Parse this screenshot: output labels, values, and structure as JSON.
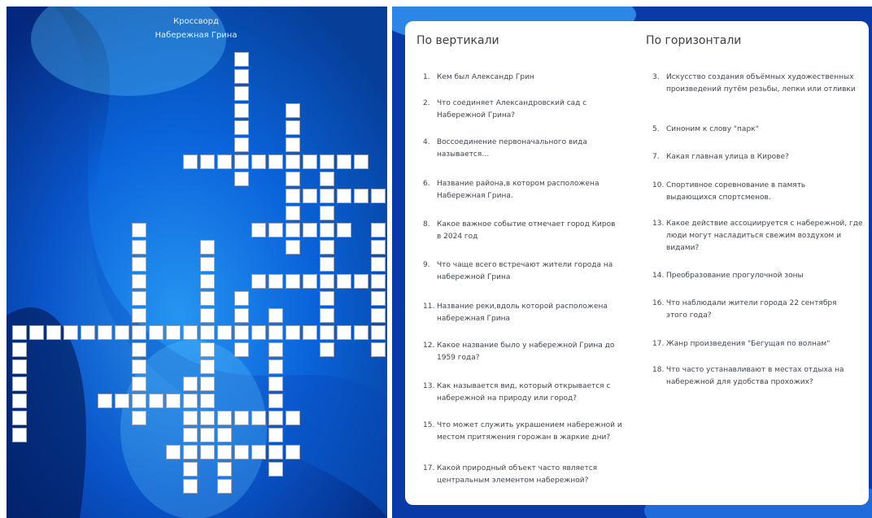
{
  "crossword": {
    "title_line1": "Кроссворд",
    "title_line2": "Набережная Грина"
  },
  "vertical": {
    "heading": "По вертикали",
    "clues": [
      {
        "num": "1.",
        "text": "Кем был Александр Грин"
      },
      {
        "num": "2.",
        "text": "Что соединяет Александровский сад с Набережной Грина?"
      },
      {
        "num": "4.",
        "text": "Воссоединение первоначального вида называется…"
      },
      {
        "num": "6.",
        "text": "Название районa,в котором расположена Набережная Грина."
      },
      {
        "num": "8.",
        "text": "Какое важное событие отмечает город Киров в 2024 год"
      },
      {
        "num": "9.",
        "text": "Что чаще всего встречают жители города на набережной Грина"
      },
      {
        "num": "11.",
        "text": "Название реки,вдоль которой расположена набережная Грина"
      },
      {
        "num": "12.",
        "text": "Какое название было у набережной Грина до 1959 года?"
      },
      {
        "num": "13.",
        "text": "Как называется вид, который открывается с набережной на природу или город?"
      },
      {
        "num": "15.",
        "text": "Что может служить украшением набережной и местом притяжения горожан в жаркие дни?"
      },
      {
        "num": "17.",
        "text": "Какой природный объект часто является центральным элементом набережной?"
      }
    ]
  },
  "horizontal": {
    "heading": "По горизонтали",
    "clues": [
      {
        "num": "3.",
        "text": "Искусство создания объёмных художественных произведений путём резьбы, лепки или отливки"
      },
      {
        "num": "5.",
        "text": "Синоним к слову \"парк\""
      },
      {
        "num": "7.",
        "text": "Какая главная улица в Кирове?"
      },
      {
        "num": "10.",
        "text": "Спортивное соревнование в память выдающихся спортсменов."
      },
      {
        "num": "13.",
        "text": "Какое действие ассоциируется с набережной, где люди могут насладиться свежим воздухом и видами?"
      },
      {
        "num": "14.",
        "text": "Преобразование прогулочной зоны"
      },
      {
        "num": "16.",
        "text": "Что наблюдали жители города 22 сентября этого года?"
      },
      {
        "num": "17.",
        "text": "Жанр произведения \"Бегущая по волнам\""
      },
      {
        "num": "18.",
        "text": "Что часто устанавливают в местах отдыха на набережной для удобства прохожих?"
      }
    ]
  },
  "colors": {
    "background_dark": "#02267a",
    "background_light": "#2f9bff",
    "card": "#ffffff"
  }
}
